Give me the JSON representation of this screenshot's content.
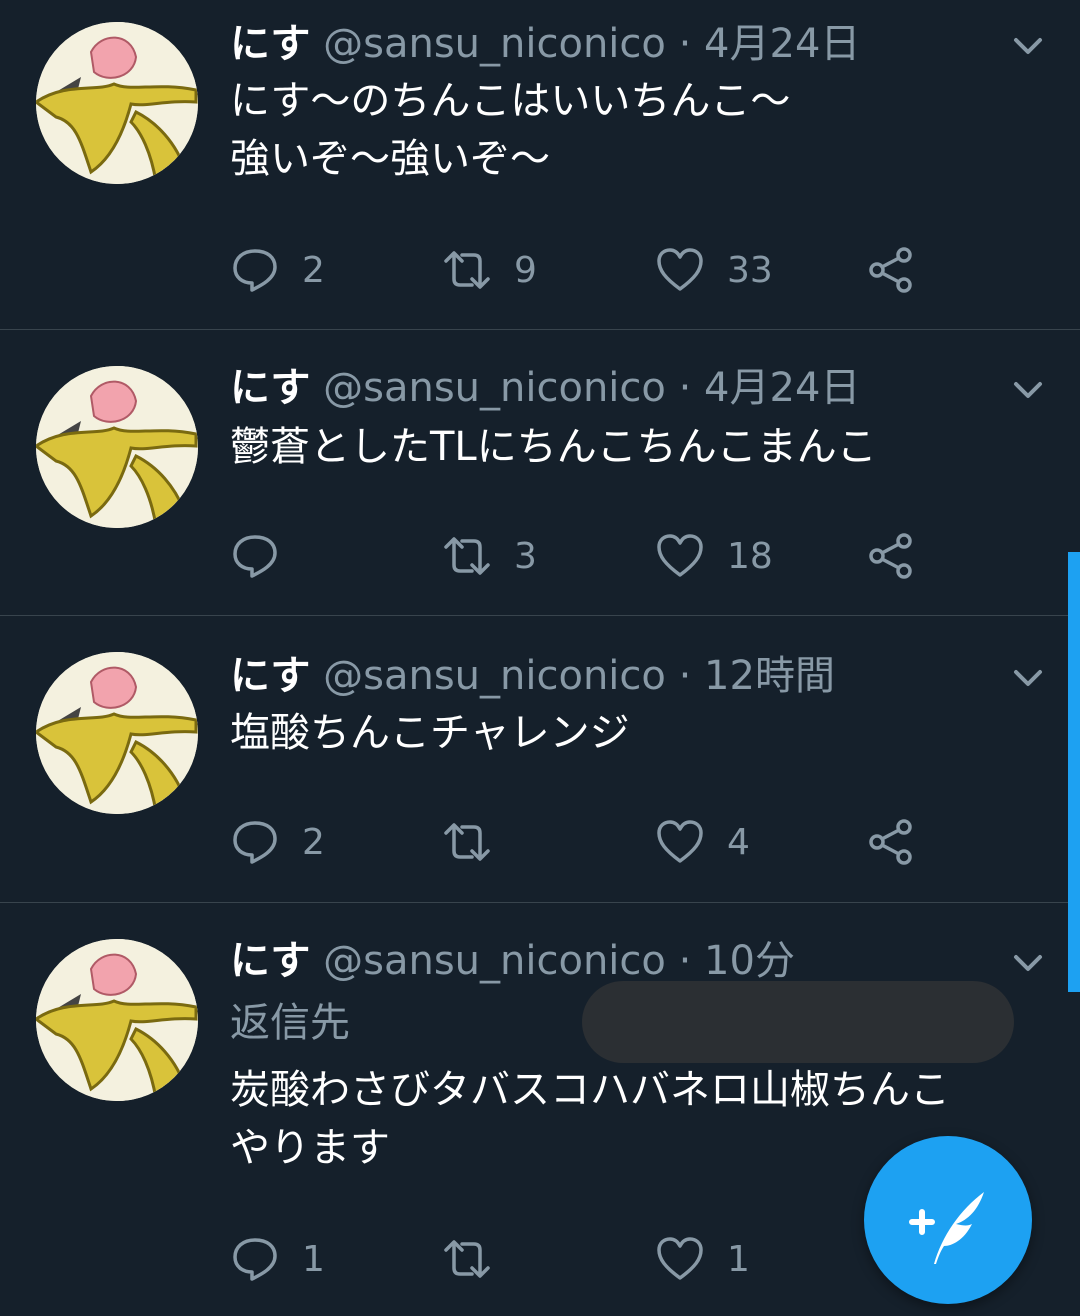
{
  "tweets": [
    {
      "name": "にす",
      "handle": "@sansu_niconico",
      "time": "4月24日",
      "lines": [
        "にす〜のちんこはいいちんこ〜",
        "強いぞ〜強いぞ〜"
      ],
      "reply_count": "2",
      "retweet_count": "9",
      "like_count": "33"
    },
    {
      "name": "にす",
      "handle": "@sansu_niconico",
      "time": "4月24日",
      "lines": [
        "鬱蒼としたTLにちんこちんこまんこ"
      ],
      "reply_count": "",
      "retweet_count": "3",
      "like_count": "18"
    },
    {
      "name": "にす",
      "handle": "@sansu_niconico",
      "time": "12時間",
      "lines": [
        "塩酸ちんこチャレンジ"
      ],
      "reply_count": "2",
      "retweet_count": "",
      "like_count": "4"
    },
    {
      "name": "にす",
      "handle": "@sansu_niconico",
      "time": "10分",
      "reply_label": "返信先",
      "lines": [
        "炭酸わさびタバスコハバネロ山椒ちんこ",
        "やります"
      ],
      "reply_count": "1",
      "retweet_count": "",
      "like_count": "1"
    }
  ],
  "separator": "·",
  "icons": {
    "reply": "speech-bubble-icon",
    "retweet": "retweet-icon",
    "like": "heart-icon",
    "share": "share-icon",
    "menu": "chevron-down-icon",
    "compose": "compose-feather-icon"
  },
  "colors": {
    "background": "#15202b",
    "accent": "#1da1f2",
    "muted": "#8899a6",
    "divider": "#38444d"
  }
}
